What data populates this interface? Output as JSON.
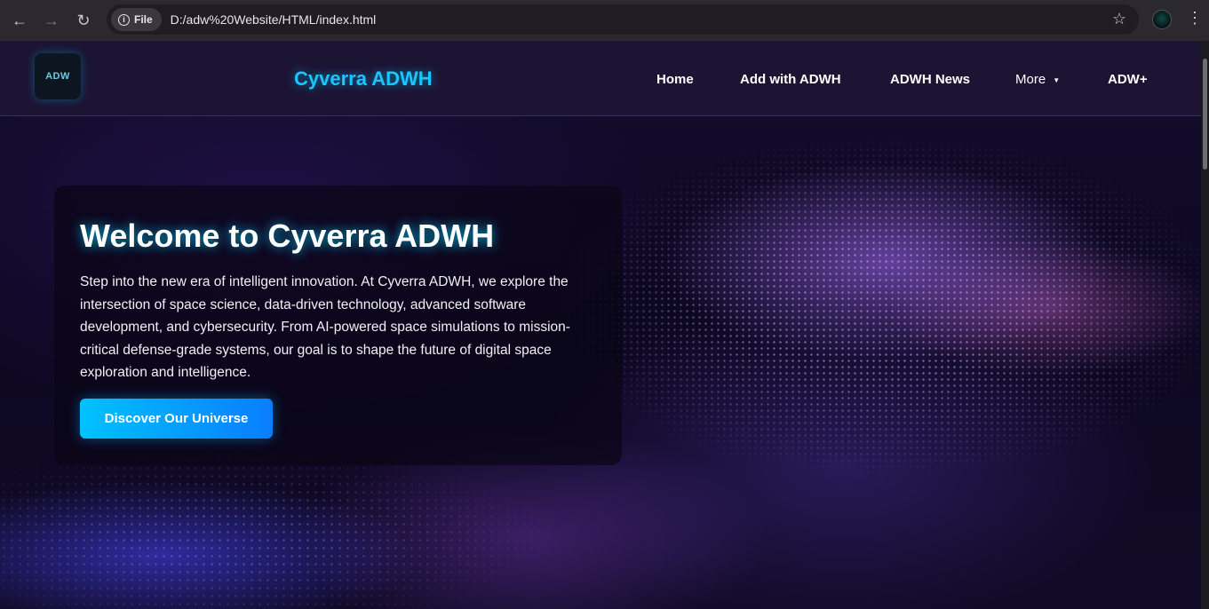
{
  "browser": {
    "back_icon": "←",
    "forward_icon": "→",
    "reload_icon": "↻",
    "site_chip_label": "File",
    "url": "D:/adw%20Website/HTML/index.html",
    "star_icon": "☆",
    "menu_icon": "⋮"
  },
  "header": {
    "logo_text": "ADW",
    "brand": "Cyverra ADWH",
    "nav": {
      "home": "Home",
      "add": "Add with ADWH",
      "news": "ADWH News",
      "more": "More",
      "more_caret": "▼",
      "plus": "ADW+"
    }
  },
  "hero": {
    "title": "Welcome to Cyverra ADWH",
    "body": "Step into the new era of intelligent innovation. At Cyverra ADWH, we explore the intersection of space science, data-driven technology, advanced software development, and cybersecurity. From AI-powered space simulations to mission-critical defense-grade systems, our goal is to shape the future of digital space exploration and intelligence.",
    "cta_label": "Discover Our Universe"
  },
  "colors": {
    "brand_accent": "#19c6ff",
    "button_start": "#00c2ff",
    "button_end": "#0a7dff"
  }
}
